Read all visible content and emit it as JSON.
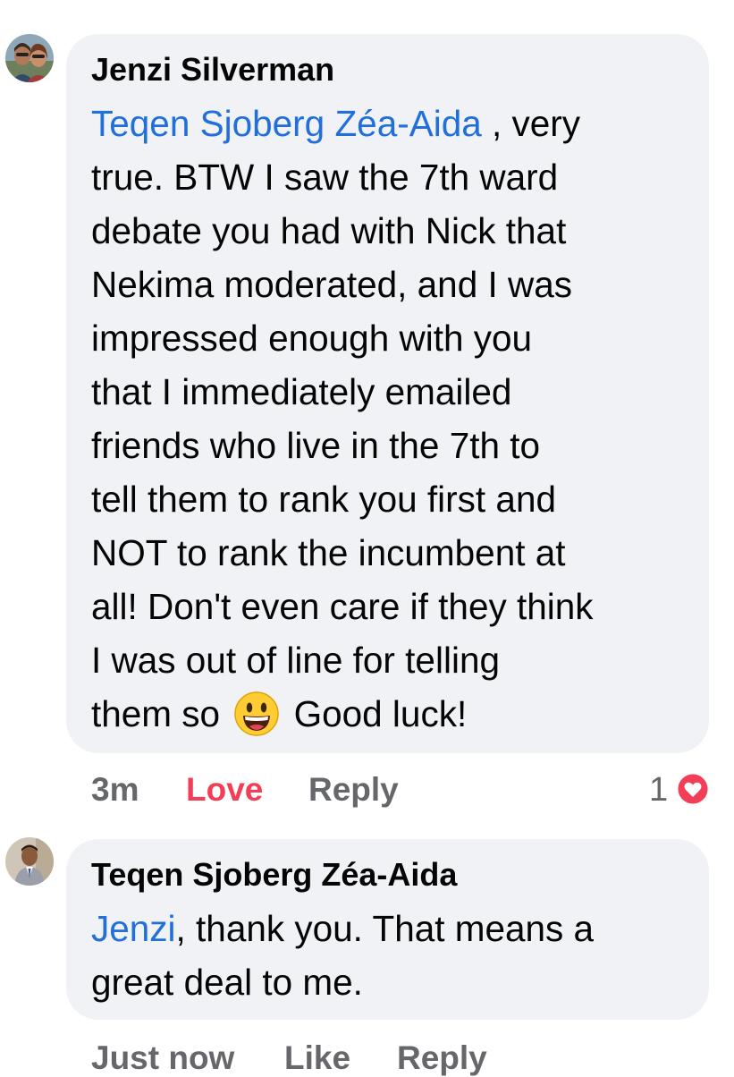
{
  "comments": [
    {
      "author": "Jenzi Silverman",
      "avatar_icon": "profile-photo-couple",
      "mention": "Teqen Sjoberg Zéa-Aida",
      "first_line_rest": " , very",
      "lines": [
        "true. BTW I saw the 7th ward",
        "debate you had with Nick that",
        "Nekima moderated, and I was",
        "impressed enough with you",
        "that I immediately emailed",
        "friends who live in the 7th to",
        "tell them to rank you first and",
        "NOT to rank the incumbent at",
        "all! Don't even care if they think",
        "I was out of line for telling"
      ],
      "last_line_before_emoji": "them so",
      "emoji_icon": "grinning-face-emoji",
      "last_line_after_emoji": "Good luck!",
      "time": "3m",
      "reaction_action": "Love",
      "reply_action": "Reply",
      "reaction_count": "1",
      "reaction_icon": "heart-reaction-icon",
      "colors": {
        "reaction_action": "#f33e58",
        "heart_badge": "#f33e58"
      }
    },
    {
      "author": "Teqen Sjoberg Zéa-Aida",
      "avatar_icon": "profile-photo-man-in-suit",
      "mention": "Jenzi",
      "first_line_rest": ", thank you. That means a",
      "lines": [
        "great deal to me."
      ],
      "time": "Just now",
      "like_action": "Like",
      "reply_action": "Reply"
    }
  ],
  "colors": {
    "bubble": "#f0f2f5",
    "mention": "#216fdb",
    "secondary_text": "#65676b",
    "text": "#050505"
  }
}
